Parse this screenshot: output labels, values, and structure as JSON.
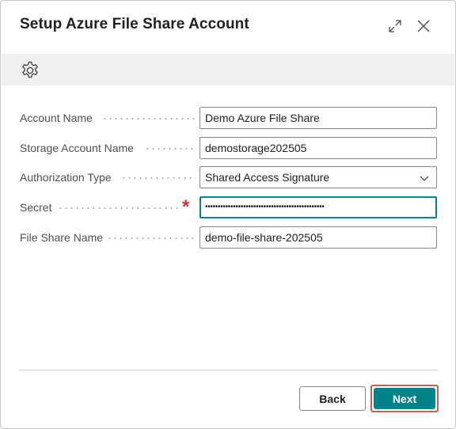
{
  "dialog": {
    "title": "Setup Azure File Share Account",
    "expand_icon": "expand-icon",
    "close_icon": "close-icon"
  },
  "toolbar": {
    "settings_icon": "gear-icon"
  },
  "fields": [
    {
      "label": "Account Name",
      "value": "Demo Azure File Share"
    },
    {
      "label": "Storage Account Name",
      "value": "demostorage202505"
    },
    {
      "label": "Authorization Type",
      "value": "Shared Access Signature",
      "type": "dropdown"
    },
    {
      "label": "Secret",
      "value": "•••••••••••••••••••••••••••••••••••••••••••••••",
      "required": true,
      "required_mark": "*"
    },
    {
      "label": "File Share Name",
      "value": "demo-file-share-202505"
    }
  ],
  "footer": {
    "back_label": "Back",
    "next_label": "Next"
  },
  "colors": {
    "accent": "#00838a",
    "required": "#d13438",
    "highlight": "#d35a52",
    "toolbar_bg": "#f0f0f0"
  }
}
